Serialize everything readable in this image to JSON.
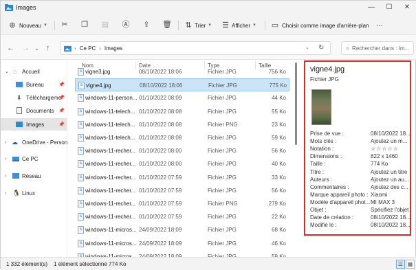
{
  "window": {
    "title": "Images",
    "minimize": "—",
    "maximize": "☐",
    "close": "✕"
  },
  "toolbar": {
    "new_label": "Nouveau",
    "sort_label": "Trier",
    "view_label": "Afficher",
    "wallpaper_label": "Choisir comme image d'arrière-plan",
    "more_label": "···"
  },
  "address": {
    "crumbs": [
      "Ce PC",
      "Images"
    ],
    "search_placeholder": "Rechercher dans : Im..."
  },
  "nav": {
    "items": [
      {
        "label": "Accueil"
      },
      {
        "label": "Bureau"
      },
      {
        "label": "Téléchargement"
      },
      {
        "label": "Documents"
      },
      {
        "label": "Images"
      },
      {
        "label": "OneDrive - Personal"
      },
      {
        "label": "Ce PC"
      },
      {
        "label": "Réseau"
      },
      {
        "label": "Linux"
      }
    ]
  },
  "list": {
    "columns": {
      "name": "Nom",
      "date": "Date",
      "type": "Type",
      "size": "Taille"
    },
    "rows": [
      {
        "name": "vigne3.jpg",
        "date": "08/10/2022 18:06",
        "type": "Fichier JPG",
        "size": "756 Ko"
      },
      {
        "name": "vigne4.jpg",
        "date": "08/10/2022 18:06",
        "type": "Fichier JPG",
        "size": "775 Ko"
      },
      {
        "name": "windows-11-person...",
        "date": "01/10/2022 08:09",
        "type": "Fichier JPG",
        "size": "44 Ko"
      },
      {
        "name": "windows-11-telech...",
        "date": "01/10/2022 08:08",
        "type": "Fichier JPG",
        "size": "55 Ko"
      },
      {
        "name": "windows-11-telech...",
        "date": "01/10/2022 08:08",
        "type": "Fichier PNG",
        "size": "23 Ko"
      },
      {
        "name": "windows-11-telech...",
        "date": "01/10/2022 08:08",
        "type": "Fichier JPG",
        "size": "59 Ko"
      },
      {
        "name": "windows-11-recher...",
        "date": "01/10/2022 08:00",
        "type": "Fichier JPG",
        "size": "56 Ko"
      },
      {
        "name": "windows-11-recher...",
        "date": "01/10/2022 08:00",
        "type": "Fichier JPG",
        "size": "40 Ko"
      },
      {
        "name": "windows-11-recher...",
        "date": "01/10/2022 07:59",
        "type": "Fichier JPG",
        "size": "33 Ko"
      },
      {
        "name": "windows-11-recher...",
        "date": "01/10/2022 07:59",
        "type": "Fichier JPG",
        "size": "56 Ko"
      },
      {
        "name": "windows-11-recher...",
        "date": "01/10/2022 07:59",
        "type": "Fichier PNG",
        "size": "279 Ko"
      },
      {
        "name": "windows-11-recher...",
        "date": "01/10/2022 07:59",
        "type": "Fichier JPG",
        "size": "22 Ko"
      },
      {
        "name": "windows-11-micros...",
        "date": "24/09/2022 18:09",
        "type": "Fichier JPG",
        "size": "68 Ko"
      },
      {
        "name": "windows-11-micros...",
        "date": "24/09/2022 18:09",
        "type": "Fichier JPG",
        "size": "46 Ko"
      },
      {
        "name": "windows-11-micros...",
        "date": "24/09/2022 18:09",
        "type": "Fichier JPG",
        "size": "59 Ko"
      }
    ]
  },
  "details": {
    "filename": "vigne4.jpg",
    "filetype": "Fichier JPG",
    "properties": [
      {
        "key": "Prise de vue :",
        "value": "08/10/2022 18..."
      },
      {
        "key": "Mots clés :",
        "value": "Ajoutez un m..."
      },
      {
        "key": "Notation :",
        "value": "☆☆☆☆☆"
      },
      {
        "key": "Dimensions :",
        "value": "822 x 1460"
      },
      {
        "key": "Taille :",
        "value": "774 Ko"
      },
      {
        "key": "Titre :",
        "value": "Ajoutez un titre"
      },
      {
        "key": "Auteurs :",
        "value": "Ajoutez un au..."
      },
      {
        "key": "Commentaires :",
        "value": "Ajoutez des c..."
      },
      {
        "key": "Marque appareil photo :",
        "value": "Xiaomi"
      },
      {
        "key": "Modèle d'appareil phot...",
        "value": "MI MAX 3"
      },
      {
        "key": "Objet :",
        "value": "Spécifiez l'objet"
      },
      {
        "key": "Date de création :",
        "value": "08/10/2022 18..."
      },
      {
        "key": "Modifié le :",
        "value": "08/10/2022 18..."
      }
    ]
  },
  "status": {
    "count": "1 332 élément(s)",
    "selection": "1 élément sélectionné  774 Ko"
  },
  "colors": {
    "accent": "#0067c0",
    "selection": "#cce4f7",
    "highlight_border": "#d32c2c"
  }
}
